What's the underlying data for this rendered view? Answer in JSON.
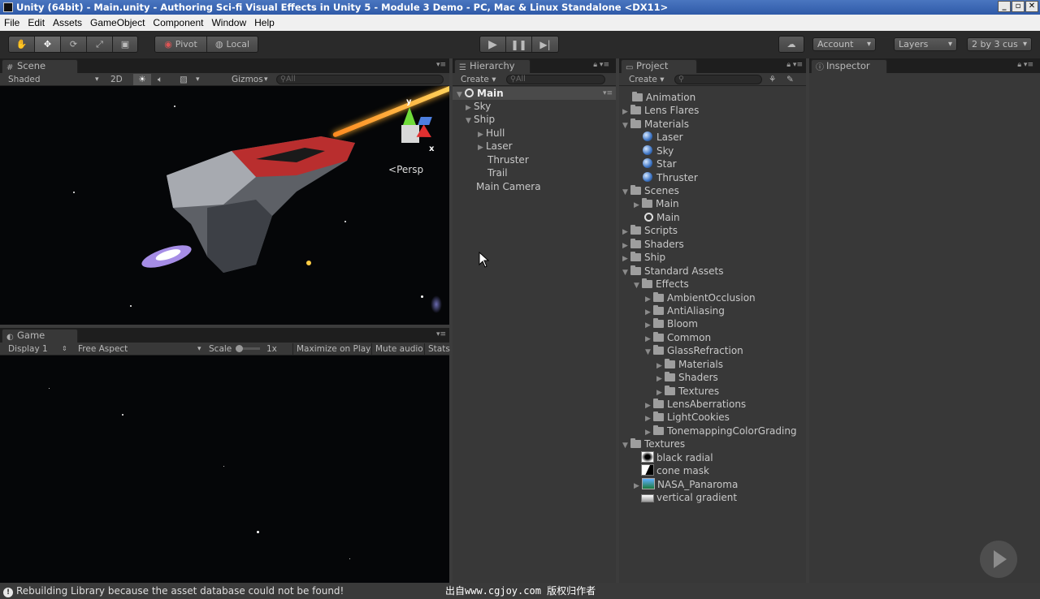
{
  "window": {
    "title": "Unity (64bit) - Main.unity - Authoring Sci-fi Visual Effects in Unity 5 - Module 3 Demo - PC, Mac & Linux Standalone <DX11>",
    "controls": [
      "_",
      "▫",
      "✕"
    ]
  },
  "menu": [
    "File",
    "Edit",
    "Assets",
    "GameObject",
    "Component",
    "Window",
    "Help"
  ],
  "toolbar": {
    "pivot_label": "Pivot",
    "local_label": "Local",
    "account_label": "Account",
    "layers_label": "Layers",
    "layout_label": "2 by 3 cus"
  },
  "scene": {
    "tab": "Scene",
    "shading": "Shaded",
    "mode_2d": "2D",
    "gizmos": "Gizmos",
    "search_placeholder": "All",
    "persp_label": "Persp",
    "axis_y": "y",
    "axis_x": "x"
  },
  "game": {
    "tab": "Game",
    "display": "Display 1",
    "aspect": "Free Aspect",
    "scale_label": "Scale",
    "scale_value": "1x",
    "maximize": "Maximize on Play",
    "mute": "Mute audio",
    "stats": "Stats"
  },
  "hierarchy": {
    "tab": "Hierarchy",
    "create": "Create",
    "search_placeholder": "All",
    "items": [
      "Main",
      "Sky",
      "Ship",
      "Hull",
      "Laser",
      "Thruster",
      "Trail",
      "Main Camera"
    ]
  },
  "project": {
    "tab": "Project",
    "create": "Create",
    "items": [
      "Animation",
      "Lens Flares",
      "Materials",
      "Laser",
      "Sky",
      "Star",
      "Thruster",
      "Scenes",
      "Main",
      "Main",
      "Scripts",
      "Shaders",
      "Ship",
      "Standard Assets",
      "Effects",
      "AmbientOcclusion",
      "AntiAliasing",
      "Bloom",
      "Common",
      "GlassRefraction",
      "Materials",
      "Shaders",
      "Textures",
      "LensAberrations",
      "LightCookies",
      "TonemappingColorGrading",
      "Textures",
      "black radial",
      "cone mask",
      "NASA_Panaroma",
      "vertical gradient"
    ]
  },
  "inspector": {
    "tab": "Inspector"
  },
  "status": {
    "message": "Rebuilding Library because the asset database could not be found!",
    "watermark": "出自www.cgjoy.com 版权归作者"
  }
}
